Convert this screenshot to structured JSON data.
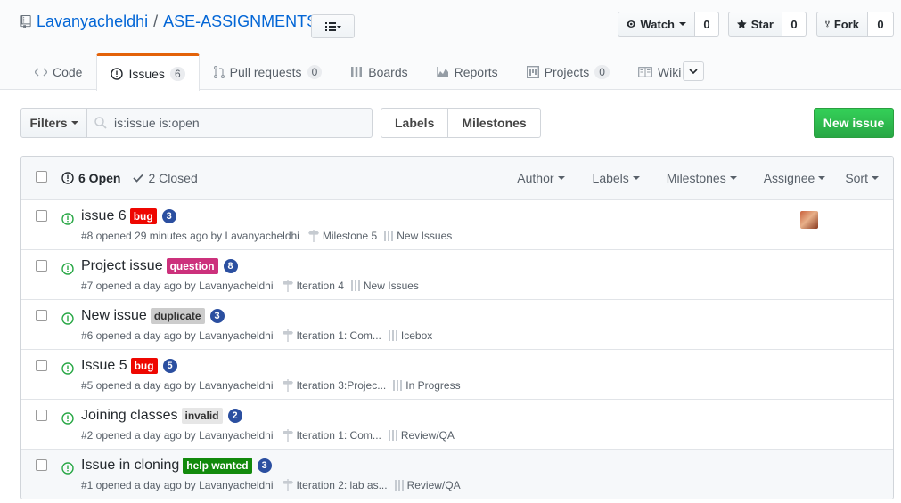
{
  "repo": {
    "owner": "Lavanyacheldhi",
    "separator": "/",
    "name": "ASE-ASSIGNMENTS"
  },
  "social": {
    "watch": {
      "label": "Watch",
      "count": "0"
    },
    "star": {
      "label": "Star",
      "count": "0"
    },
    "fork": {
      "label": "Fork",
      "count": "0"
    }
  },
  "tabs": [
    {
      "label": "Code",
      "count": null,
      "icon": "code-icon"
    },
    {
      "label": "Issues",
      "count": "6",
      "icon": "issue-opened-icon"
    },
    {
      "label": "Pull requests",
      "count": "0",
      "icon": "git-pull-request-icon"
    },
    {
      "label": "Boards",
      "count": null,
      "icon": "boards-icon"
    },
    {
      "label": "Reports",
      "count": null,
      "icon": "graph-icon"
    },
    {
      "label": "Projects",
      "count": "0",
      "icon": "project-icon"
    },
    {
      "label": "Wiki",
      "count": null,
      "icon": "book-icon"
    }
  ],
  "filter": {
    "filters_label": "Filters",
    "search_value": "is:issue is:open",
    "labels_label": "Labels",
    "milestones_label": "Milestones",
    "new_issue_label": "New issue"
  },
  "list_header": {
    "open_label": "6 Open",
    "closed_label": "2 Closed",
    "menus": [
      "Author",
      "Labels",
      "Milestones",
      "Assignee",
      "Sort"
    ]
  },
  "issues": [
    {
      "title": "issue 6",
      "label": "bug",
      "bubble": "3",
      "meta": "#8 opened 29 minutes ago by Lavanyacheldhi",
      "milestone": "Milestone 5",
      "project": "New Issues",
      "avatar": true
    },
    {
      "title": "Project issue",
      "label": "question",
      "bubble": "8",
      "meta": "#7 opened a day ago by Lavanyacheldhi",
      "milestone": "Iteration 4",
      "project": "New Issues",
      "avatar": false
    },
    {
      "title": "New issue",
      "label": "duplicate",
      "bubble": "3",
      "meta": "#6 opened a day ago by Lavanyacheldhi",
      "milestone": "Iteration 1: Com...",
      "project": "Icebox",
      "avatar": false
    },
    {
      "title": "Issue 5",
      "label": "bug",
      "bubble": "5",
      "meta": "#5 opened a day ago by Lavanyacheldhi",
      "milestone": "Iteration 3:Projec...",
      "project": "In Progress",
      "avatar": false
    },
    {
      "title": "Joining classes",
      "label": "invalid",
      "bubble": "2",
      "meta": "#2 opened a day ago by Lavanyacheldhi",
      "milestone": "Iteration 1: Com...",
      "project": "Review/QA",
      "avatar": false
    },
    {
      "title": "Issue in cloning",
      "label": "help wanted",
      "bubble": "3",
      "meta": "#1 opened a day ago by Lavanyacheldhi",
      "milestone": "Iteration 2: lab as...",
      "project": "Review/QA",
      "avatar": false
    }
  ],
  "label_colors": {
    "bug": {
      "bg": "#ee0701",
      "fg": "#ffffff"
    },
    "question": {
      "bg": "#cc317c",
      "fg": "#ffffff"
    },
    "duplicate": {
      "bg": "#cccccc",
      "fg": "#333333"
    },
    "invalid": {
      "bg": "#e6e6e6",
      "fg": "#333333"
    },
    "help wanted": {
      "bg": "#128a0c",
      "fg": "#ffffff"
    }
  },
  "colors": {
    "accent": "#0366d6",
    "open_green": "#28a745",
    "tab_orange": "#e36209",
    "bubble_blue": "#2b4fa0"
  }
}
